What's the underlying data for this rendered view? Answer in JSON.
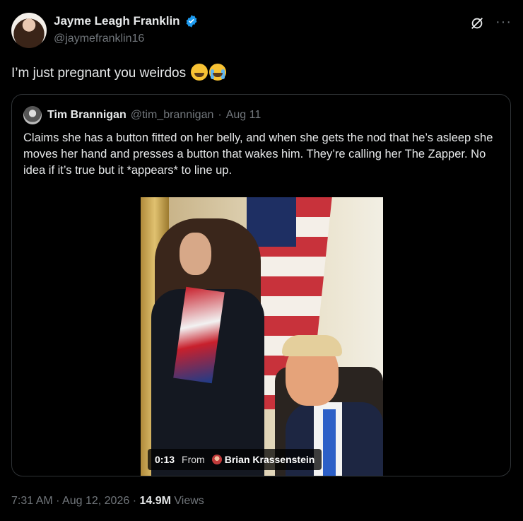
{
  "author": {
    "display_name": "Jayme Leagh Franklin",
    "handle": "@jaymefranklin16",
    "verified": true
  },
  "tweet": {
    "text": "I’m just pregnant you weirdos",
    "emojis": [
      "face-with-tears-of-joy",
      "loudly-crying-face"
    ]
  },
  "quoted_tweet": {
    "display_name": "Tim Brannigan",
    "handle": "@tim_brannigan",
    "separator": "·",
    "date": "Aug 11",
    "text": "Claims she has a button fitted on her belly, and when she gets the nod that he’s asleep she moves her hand and presses a button that wakes him. They’re calling her The Zapper. No idea if it’s true but it *appears* to line up.",
    "media": {
      "type": "video",
      "duration": "0:13",
      "from_label": "From",
      "source_name": "Brian Krassenstein"
    }
  },
  "footer": {
    "time": "7:31 AM",
    "sep1": "·",
    "date": "Aug 12, 2026",
    "sep2": "·",
    "views_count": "14.9M",
    "views_label": "Views"
  },
  "icons": {
    "verified": "verified-badge-icon",
    "grok": "grok-icon",
    "more": "more-icon"
  },
  "colors": {
    "background": "#000000",
    "text": "#e7e9ea",
    "secondary_text": "#71767b",
    "verified_blue": "#1d9bf0",
    "border": "#2f3336"
  }
}
